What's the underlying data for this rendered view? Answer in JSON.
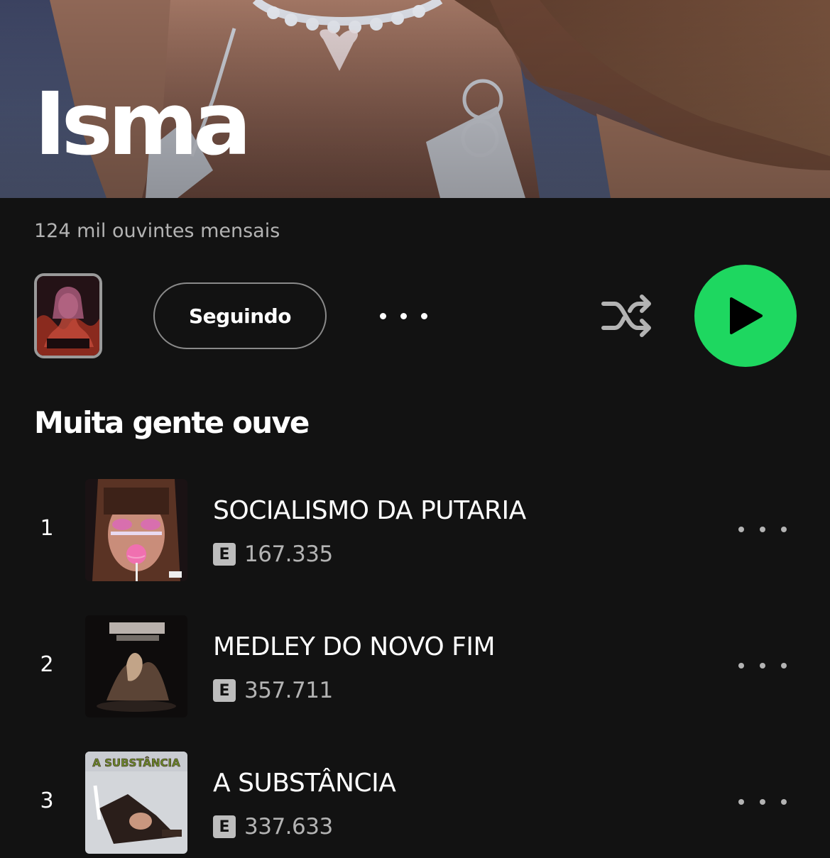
{
  "artist": {
    "name": "Isma",
    "monthly_listeners": "124 mil ouvintes mensais"
  },
  "actions": {
    "follow_label": "Seguindo",
    "more_icon": "more-horizontal-icon",
    "shuffle_icon": "shuffle-icon",
    "play_icon": "play-icon"
  },
  "colors": {
    "background": "#121212",
    "accent": "#1ed760",
    "secondary_text": "#b3b3b3"
  },
  "popular": {
    "title": "Muita gente ouve",
    "tracks": [
      {
        "index": "1",
        "title": "SOCIALISMO DA PUTARIA",
        "explicit": "E",
        "plays": "167.335"
      },
      {
        "index": "2",
        "title": "MEDLEY DO NOVO FIM",
        "explicit": "E",
        "plays": "357.711"
      },
      {
        "index": "3",
        "title": "A SUBSTÂNCIA",
        "explicit": "E",
        "plays": "337.633",
        "art_text": "A SUBSTÂNCIA"
      }
    ]
  }
}
